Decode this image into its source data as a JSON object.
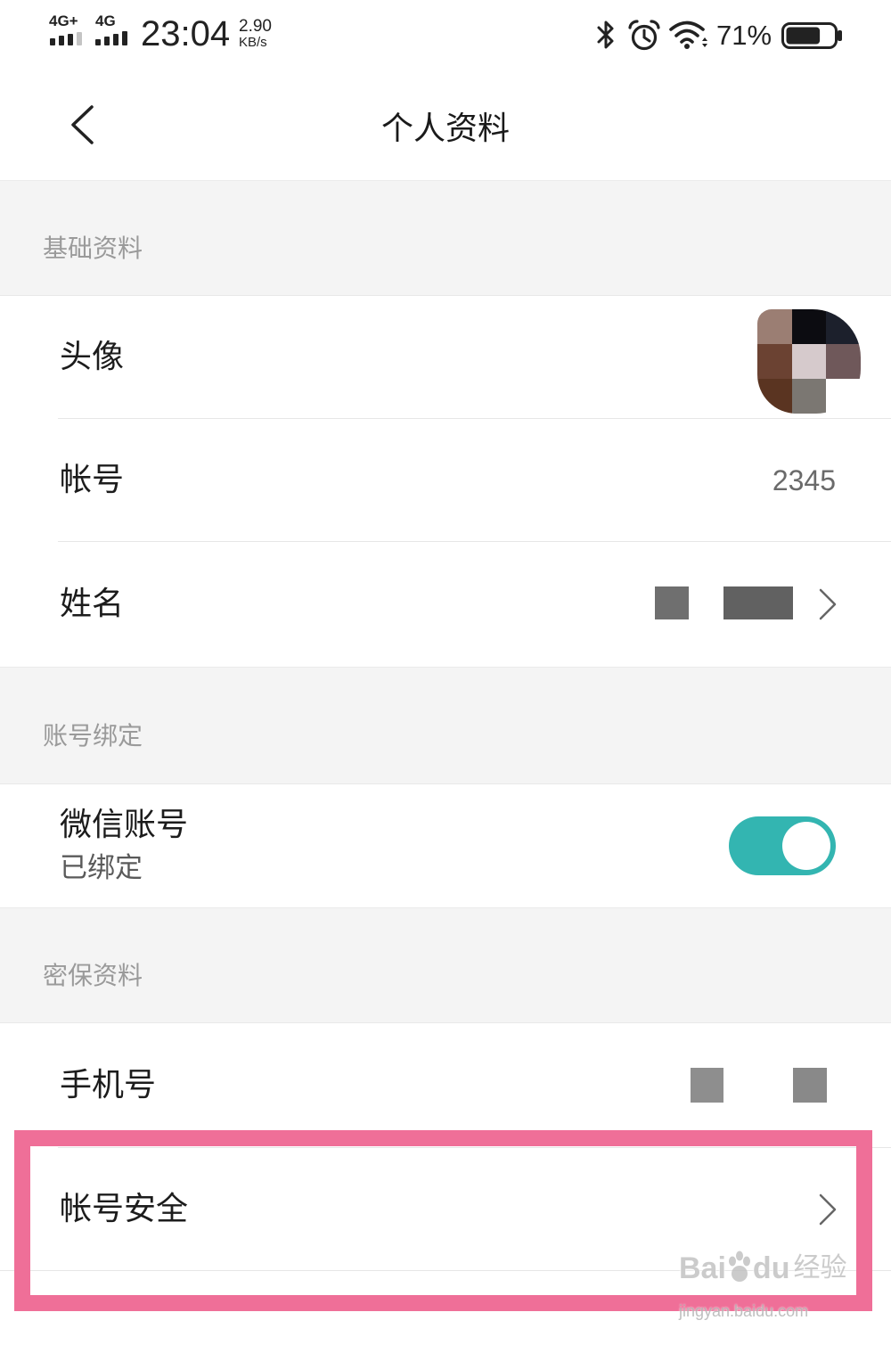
{
  "status_bar": {
    "signal_1_label": "4G+",
    "signal_1_level": 3,
    "signal_2_label": "4G",
    "signal_2_level": 4,
    "time": "23:04",
    "net_speed": "2.90",
    "net_speed_unit": "KB/s",
    "battery_text": "71%",
    "battery_level": 0.71,
    "icons": [
      "bluetooth-icon",
      "alarm-clock-icon",
      "wifi-icon",
      "battery-icon"
    ]
  },
  "header": {
    "title": "个人资料",
    "back_icon": "chevron-left-icon"
  },
  "basic_info": {
    "section_title": "基础资料",
    "avatar": {
      "label": "头像",
      "pixels": [
        [
          "#9B7E73",
          "#0C0C11",
          "#1C202C"
        ],
        [
          "#6B4232",
          "#D6CACC",
          "#6F585A"
        ],
        [
          "#5A3421",
          "#7B7772",
          "#FFFFFF"
        ]
      ]
    },
    "account": {
      "label": "帐号",
      "value": "2345"
    },
    "name": {
      "label": "姓名",
      "chevron_icon": "chevron-right-icon"
    }
  },
  "account_binding": {
    "section_title": "账号绑定",
    "wechat": {
      "label": "微信账号",
      "status": "已绑定",
      "toggle_on": true
    }
  },
  "security_info": {
    "section_title": "密保资料",
    "phone": {
      "label": "手机号"
    },
    "account_security": {
      "label": "帐号安全",
      "chevron_icon": "chevron-right-icon"
    }
  },
  "colors": {
    "toggle_on": "#33B5B1",
    "highlight_border": "#EF6F98",
    "section_background": "#F4F4F4",
    "section_title_text": "#9A9A9A"
  },
  "watermark": {
    "brand_part_1": "Bai",
    "brand_part_2": "du",
    "brand_cn": "经验",
    "url": "jingyan.baidu.com"
  }
}
